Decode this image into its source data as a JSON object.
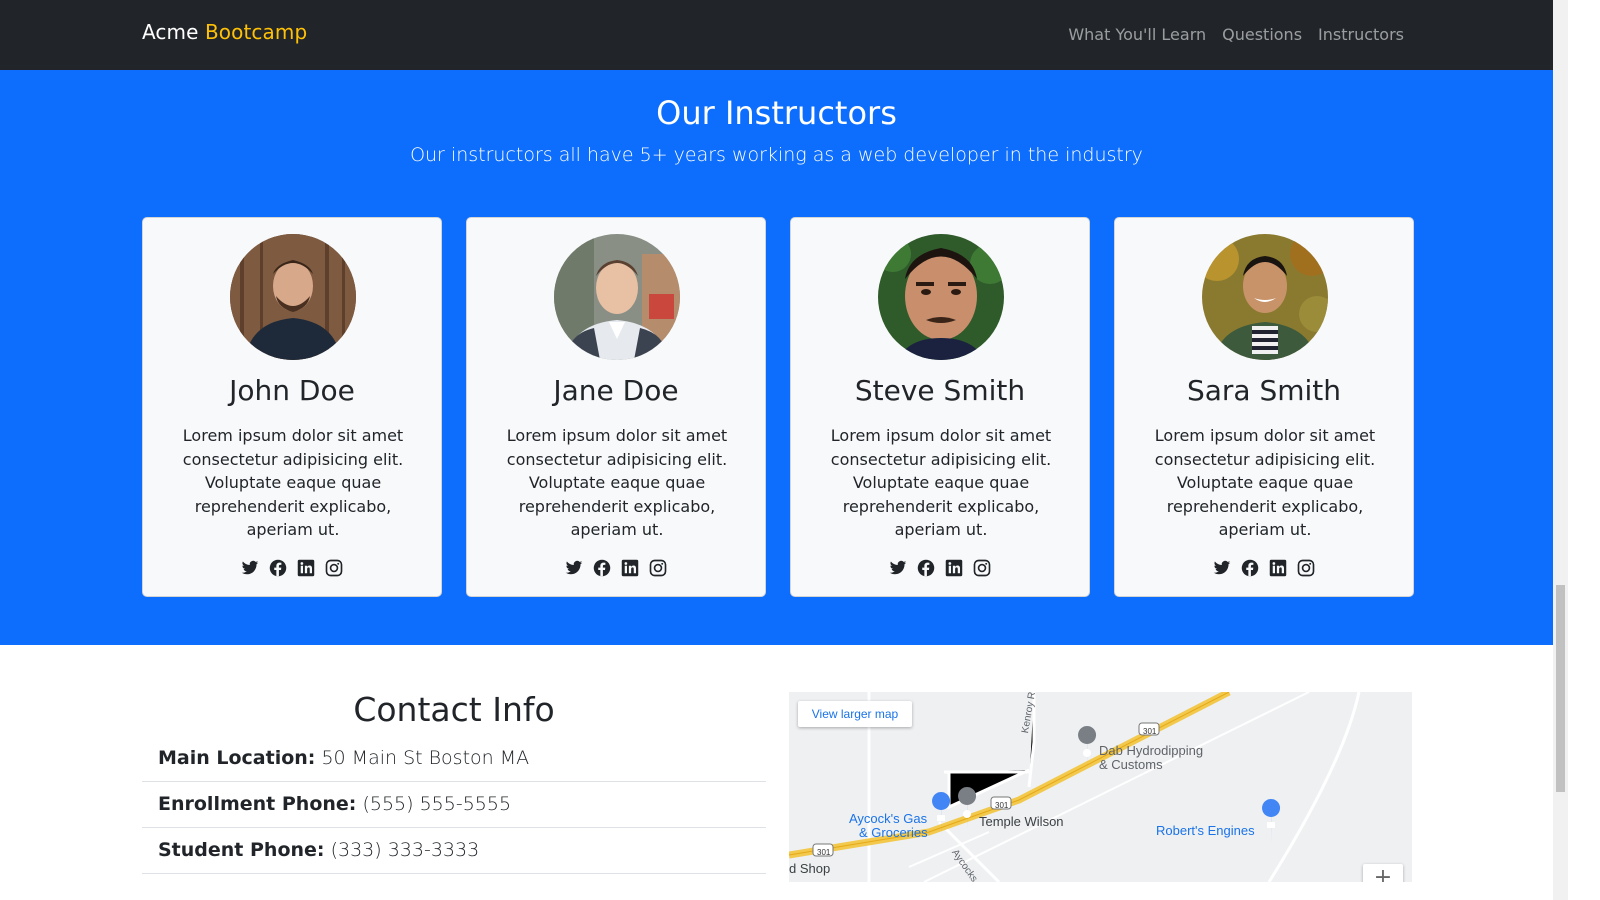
{
  "navbar": {
    "brand_first": "Acme",
    "brand_second": "Bootcamp",
    "links": [
      "What You'll Learn",
      "Questions",
      "Instructors"
    ]
  },
  "instructors": {
    "title": "Our Instructors",
    "lead": "Our instructors all have 5+ years working as a web developer in the industry",
    "cards": [
      {
        "name": "John Doe",
        "bio": "Lorem ipsum dolor sit amet consectetur adipisicing elit. Voluptate eaque quae reprehenderit explicabo, aperiam ut."
      },
      {
        "name": "Jane Doe",
        "bio": "Lorem ipsum dolor sit amet consectetur adipisicing elit. Voluptate eaque quae reprehenderit explicabo, aperiam ut."
      },
      {
        "name": "Steve Smith",
        "bio": "Lorem ipsum dolor sit amet consectetur adipisicing elit. Voluptate eaque quae reprehenderit explicabo, aperiam ut."
      },
      {
        "name": "Sara Smith",
        "bio": "Lorem ipsum dolor sit amet consectetur adipisicing elit. Voluptate eaque quae reprehenderit explicabo, aperiam ut."
      }
    ],
    "social_icons": [
      "twitter-icon",
      "facebook-icon",
      "linkedin-icon",
      "instagram-icon"
    ]
  },
  "contact": {
    "title": "Contact Info",
    "items": [
      {
        "label": "Main Location:",
        "value": "50 Main St Boston MA"
      },
      {
        "label": "Enrollment Phone:",
        "value": "(555) 555-5555"
      },
      {
        "label": "Student Phone:",
        "value": "(333) 333-3333"
      }
    ]
  },
  "map": {
    "view_larger": "View larger map",
    "labels": {
      "dab": "Dab Hydrodipping",
      "dab2": "& Customs",
      "aycock": "Aycock's Gas",
      "aycock2": "& Groceries",
      "temple": "Temple Wilson",
      "roberts": "Robert's Engines",
      "shop": "d Shop",
      "kenroy": "Kenroy Rd",
      "aycocks_rd": "Aycocks C",
      "route": "301"
    },
    "zoom_in": "+"
  },
  "colors": {
    "navbar": "#212529",
    "brand_accent": "#ffc107",
    "section_bg": "#0d6efd",
    "card_bg": "#f8f9fa"
  }
}
